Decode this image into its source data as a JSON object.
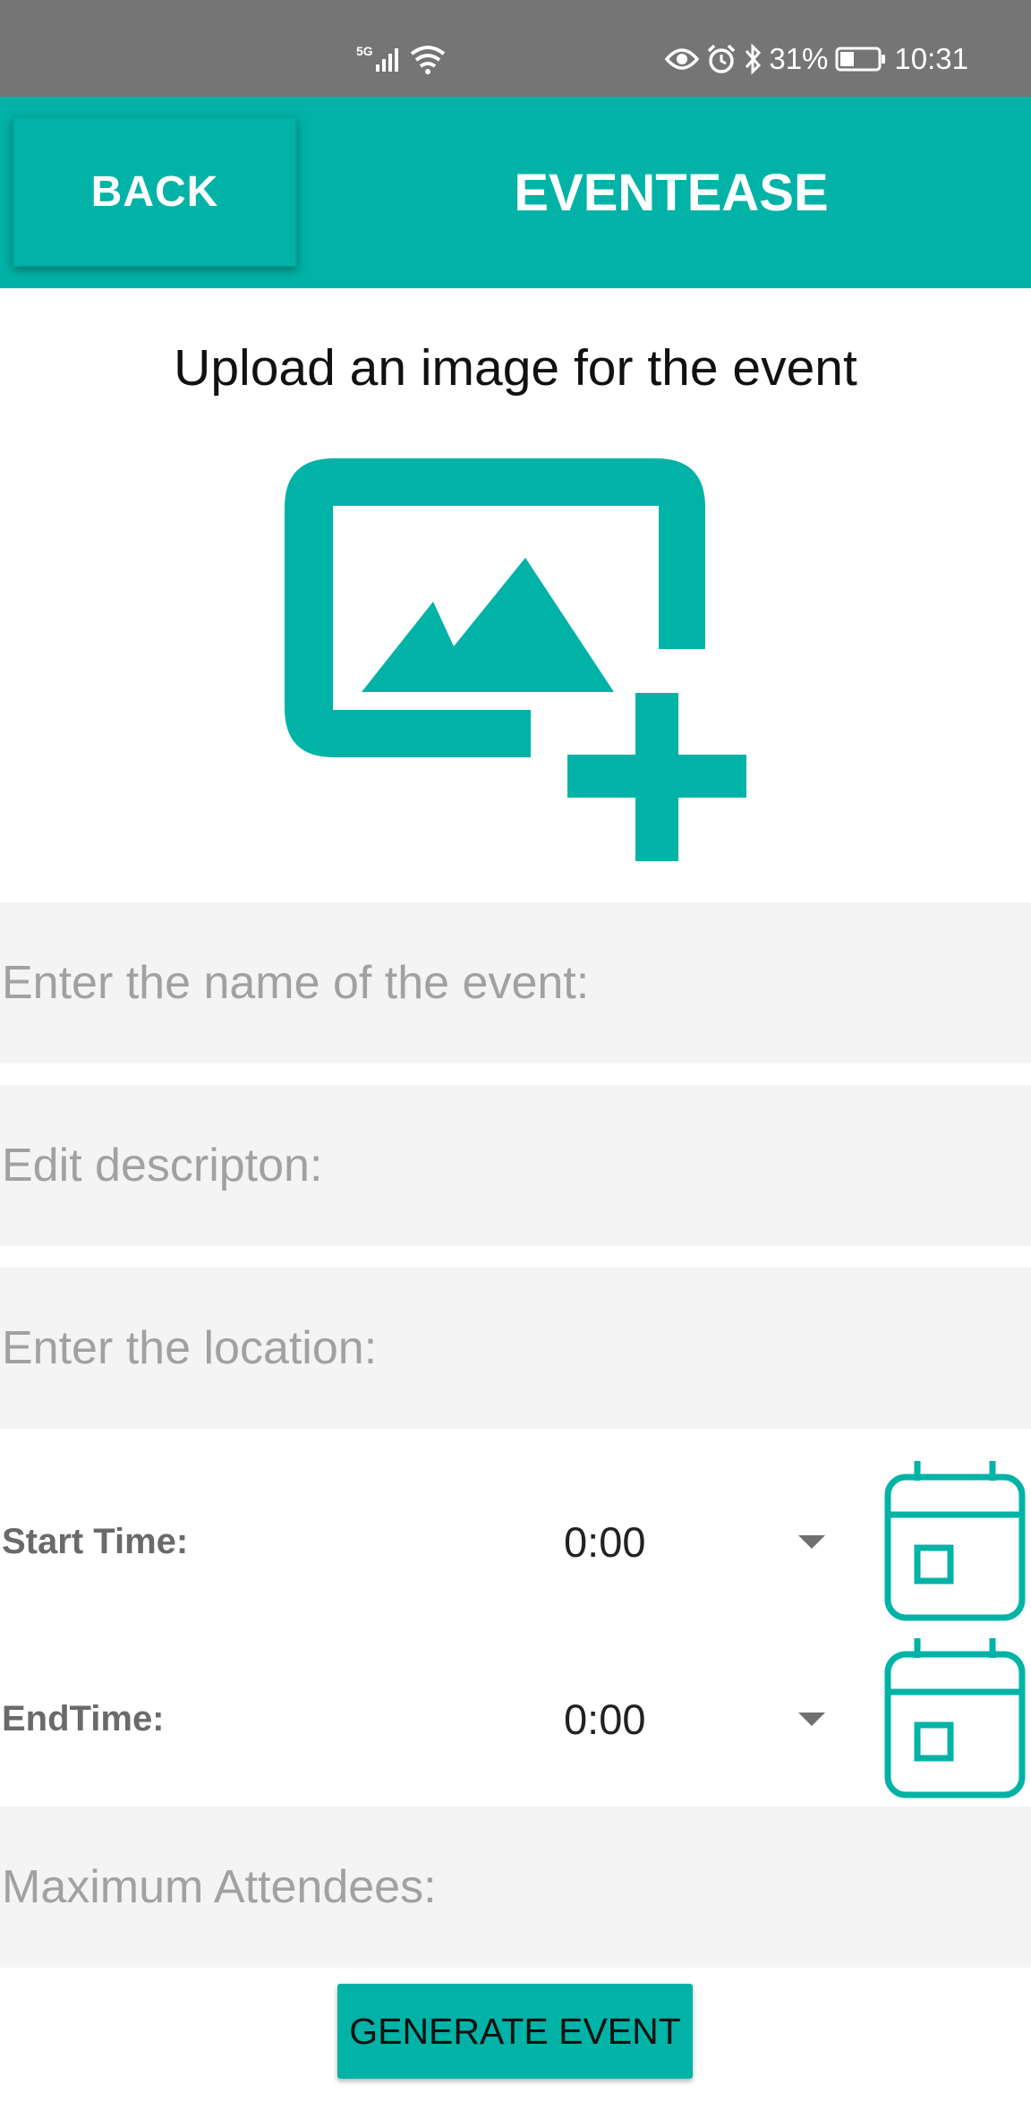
{
  "status_bar": {
    "network_label": "5G",
    "battery_percent": "31%",
    "time": "10:31",
    "icons": [
      "signal-icon",
      "wifi-icon",
      "eye-icon",
      "alarm-icon",
      "bluetooth-icon",
      "battery-icon"
    ]
  },
  "header": {
    "back_label": "BACK",
    "title": "EVENTEASE"
  },
  "upload": {
    "heading": "Upload an image for the event",
    "icon": "add-photo-icon"
  },
  "form": {
    "event_name_placeholder": "Enter the name of the event:",
    "description_placeholder": "Edit descripton:",
    "location_placeholder": "Enter the location:",
    "start_time_label": "Start Time:",
    "start_time_value": "0:00",
    "end_time_label": "EndTime:",
    "end_time_value": "0:00",
    "max_attendees_placeholder": "Maximum Attendees:",
    "generate_label": "GENERATE EVENT"
  },
  "colors": {
    "accent": "#00b3a6",
    "status_bar": "#757575",
    "field_background": "#f4f4f4",
    "placeholder_text": "#a1a1a1"
  }
}
